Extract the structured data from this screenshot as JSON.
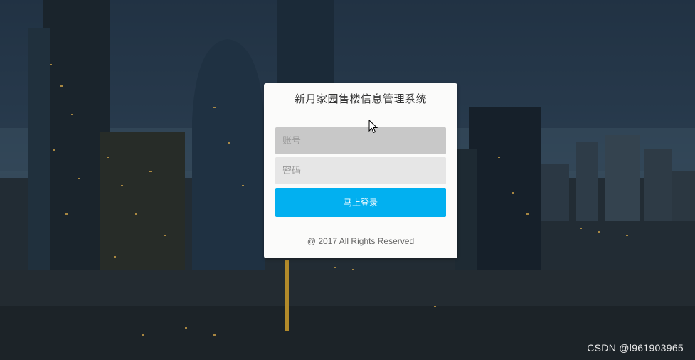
{
  "login": {
    "title": "新月家园售楼信息管理系统",
    "account_placeholder": "账号",
    "password_placeholder": "密码",
    "submit_label": "马上登录",
    "copyright": "@ 2017 All Rights Reserved"
  },
  "watermark": "CSDN @l961903965",
  "colors": {
    "accent": "#02b0f0",
    "card": "#fbfbfa",
    "account_field": "#c8c8c8",
    "password_field": "#e6e6e6"
  },
  "icons": {
    "cursor": "mouse-pointer-icon"
  }
}
